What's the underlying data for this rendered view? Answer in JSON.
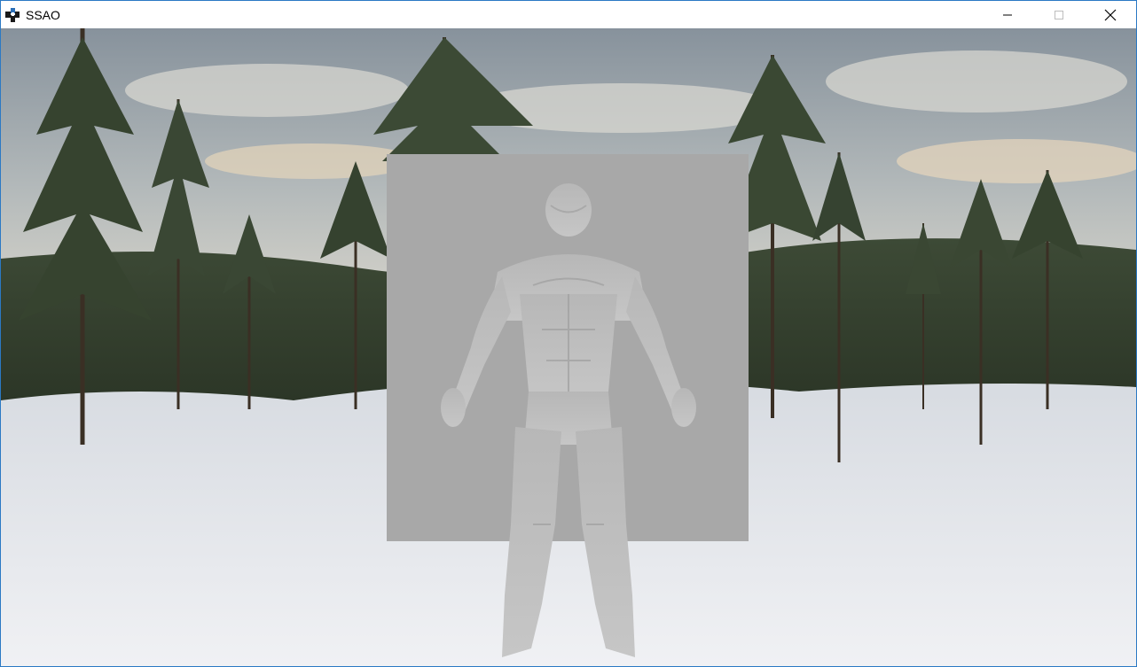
{
  "window": {
    "title": "SSAO",
    "icon": "app-cube-icon",
    "controls": [
      "minimize-icon",
      "maximize-icon",
      "close-icon"
    ]
  },
  "scene": {
    "description_icon": "skybox-snow-forest",
    "model_icon": "humanoid-armor-model",
    "colors": {
      "sky_top": "#8e9aa6",
      "sky_mid": "#c8ccca",
      "sky_warm": "#e6d3b6",
      "snow": "#e6e8ec",
      "trees": "#2e3a2c",
      "quad": "#a7a7a7",
      "model": "#bdbdbd"
    }
  }
}
